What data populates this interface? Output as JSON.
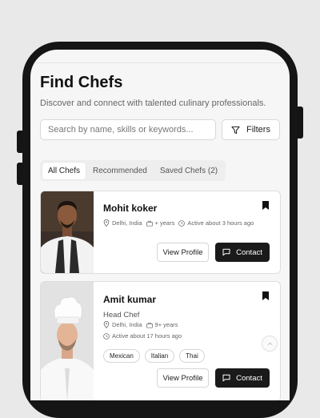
{
  "page": {
    "title": "Find Chefs",
    "subtitle": "Discover and connect with talented culinary professionals."
  },
  "search": {
    "placeholder": "Search by name, skills or keywords..."
  },
  "filters": {
    "label": "Filters",
    "icon": "filter-icon"
  },
  "tabs": [
    {
      "label": "All Chefs",
      "active": true
    },
    {
      "label": "Recommended",
      "active": false
    },
    {
      "label": "Saved Chefs (2)",
      "active": false
    }
  ],
  "chefs": [
    {
      "name": "Mohit koker",
      "role": "",
      "location": "Delhi, India",
      "experience": "+ years",
      "active": "Active about 3 hours ago",
      "cuisines": [],
      "view_label": "View Profile",
      "contact_label": "Contact"
    },
    {
      "name": "Amit kumar",
      "role": "Head Chef",
      "location": "Delhi, India",
      "experience": "9+ years",
      "active": "Active about 17 hours ago",
      "cuisines": [
        "Mexican",
        "Italian",
        "Thai"
      ],
      "view_label": "View Profile",
      "contact_label": "Contact"
    }
  ],
  "colors": {
    "accent": "#1a1a1a",
    "background": "#f6f6f6",
    "frame": "#151515"
  }
}
